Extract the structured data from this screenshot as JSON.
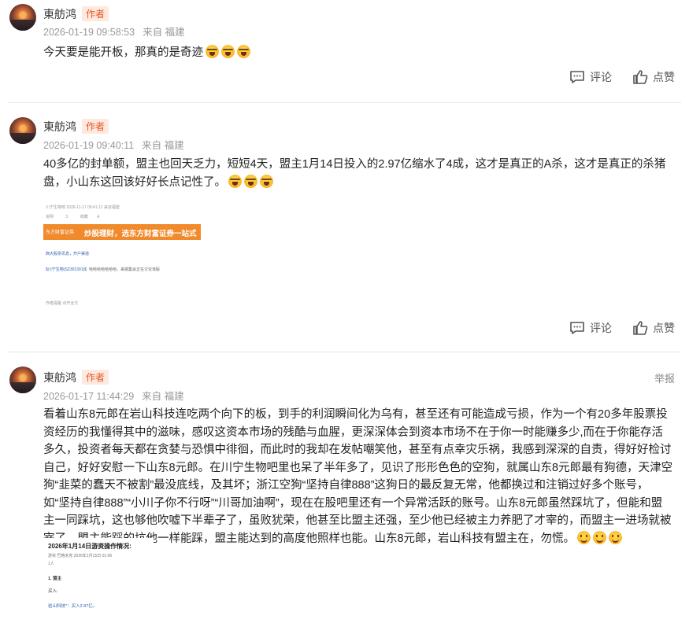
{
  "posts": [
    {
      "author": "東舫鸿",
      "badge": "作者",
      "time": "2026-01-19 09:58:53",
      "location": "来自 福建",
      "content": "今天要是能开板，那真的是奇迹",
      "emojis": [
        "cry-laugh",
        "cry-laugh",
        "cry-laugh"
      ],
      "comment_label": "评论",
      "like_label": "点赞"
    },
    {
      "author": "東舫鸿",
      "badge": "作者",
      "time": "2026-01-19 09:40:11",
      "location": "来自 福建",
      "content": "40多亿的封单额，盟主也回天乏力，短短4天，盟主1月14日投入的2.97亿缩水了4成，这才是真正的A杀，这才是真正的杀猪盘，小山东这回该好好长点记性了。",
      "emojis": [
        "cry-laugh",
        "cry-laugh",
        "cry-laugh"
      ],
      "comment_label": "评论",
      "like_label": "点赞",
      "image": {
        "header": "川宁生物吧 2026-11-17 09:41:12 来自福建",
        "toolbar": [
          "3",
          "收藏",
          "A"
        ],
        "toolbar_first": "说明",
        "banner_logo": "东方财富证券",
        "banner_text": "炒股理财，选东方财富证券一站式",
        "link1": "西大股票讯息，开户渠道",
        "link2": "$川宁生物(SZ301301)$",
        "link2_text": "哈哈哈哈哈哈哈，来做集会正在讨论该股",
        "footer": "作者提醒 点开全文"
      }
    },
    {
      "author": "東舫鸿",
      "badge": "作者",
      "time": "2026-01-17 11:44:29",
      "location": "来自 福建",
      "report": "举报",
      "content": "看着山东8元郎在岩山科技连吃两个向下的板，到手的利润瞬间化为乌有，甚至还有可能造成亏损，作为一个有20多年股票投资经历的我懂得其中的滋味，感叹这资本市场的残酷与血腥，更深深体会到资本市场不在于你一时能赚多少,而在于你能存活多久，投资者每天都在贪婪与恐惧中徘徊，而此时的我却在发帖嘲笑他，甚至有点幸灾乐祸，我感到深深的自责，得好好检讨自己，好好安慰一下山东8元郎。在川宁生物吧里也呆了半年多了，见识了形形色色的空狗，就属山东8元郎最有狗德，天津空狗“韭菜的蠢天不被割”最没底线，及其坏；浙江空狗“坚持自律888”这狗日的最反复无常，他都换过和注销过好多个账号，如“坚持自律888”“小川子你不行呀”“川哥加油啊”，现在在股吧里还有一个异常活跃的账号。山东8元郎虽然踩坑了，但能和盟主一同踩坑，这也够他吹嘘下半辈子了，虽败犹荣，他甚至比盟主还强，至少他已经被主力养肥了才宰的，而盟主一进场就被宰了，盟主能踩的坑他一样能踩，盟主能达到的高度他照样也能。山东8元郎，岩山科技有盟主在，勿慌。",
      "emojis": [
        "smile",
        "smile",
        "smile"
      ],
      "image": {
        "title": "2026年1月14日游资操作情况:",
        "meta": "游资  巴格米克  2026年1月15日 01:06",
        "like": "1人",
        "section": "1. 盟主",
        "buy": "买入:",
        "item": "岩山科技*：买入2.97亿。"
      }
    }
  ]
}
